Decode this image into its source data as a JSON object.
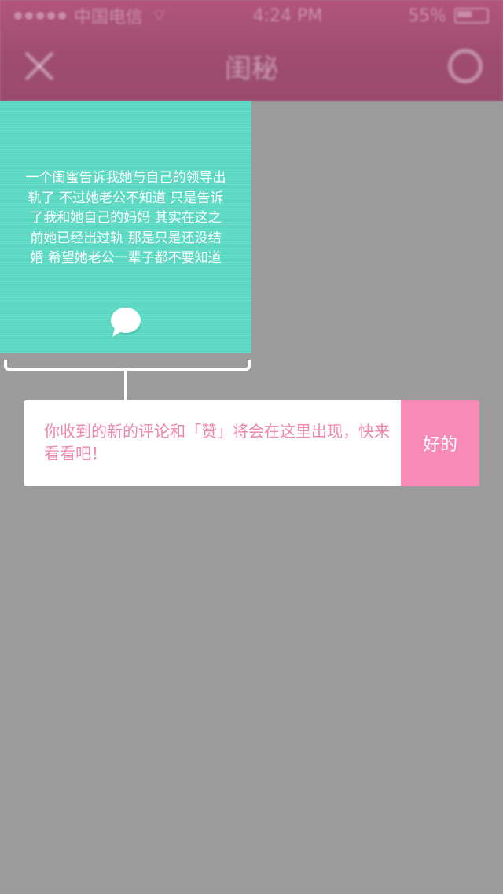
{
  "status_bar": {
    "carrier": "中国电信",
    "wifi": "wifi",
    "time": "4:24 PM",
    "battery": "55%"
  },
  "nav": {
    "title": "闺秘",
    "close_icon": "close-icon",
    "settings_icon": "gear-icon"
  },
  "card": {
    "text": "一个闺蜜告诉我她与自己的领导出轨了 不过她老公不知道 只是告诉了我和她自己的妈妈 其实在这之前她已经出过轨 那是只是还没结婚 希望她老公一辈子都不要知道",
    "icon": "speech-bubble-icon",
    "background_color": "#5ddcc6"
  },
  "tip": {
    "message": "你收到的新的评论和「赞」将会在这里出现，快来看看吧！",
    "ok_label": "好的",
    "text_color": "#ef86ae",
    "button_color": "#f78ab6"
  }
}
